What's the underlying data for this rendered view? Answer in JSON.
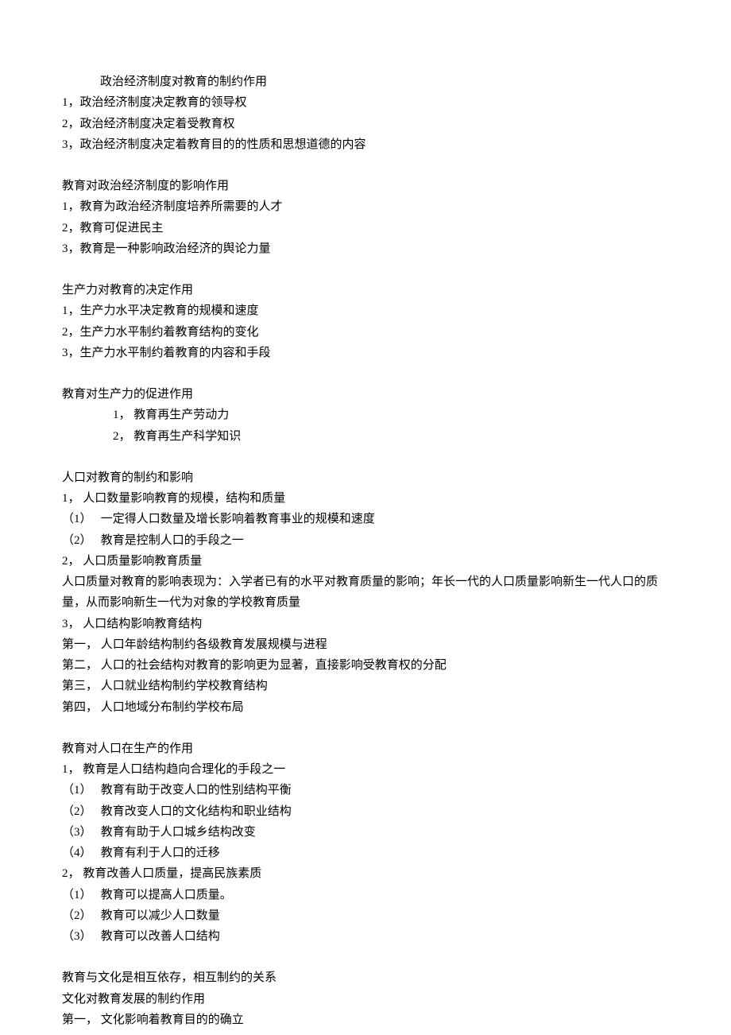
{
  "lines": [
    {
      "cls": "indent1",
      "text": "政治经济制度对教育的制约作用"
    },
    {
      "cls": "",
      "text": "1，政治经济制度决定教育的领导权"
    },
    {
      "cls": "",
      "text": "2，政治经济制度决定着受教育权"
    },
    {
      "cls": "",
      "text": "3，政治经济制度决定着教育目的的性质和思想道德的内容"
    },
    {
      "cls": "blank",
      "text": ""
    },
    {
      "cls": "",
      "text": "教育对政治经济制度的影响作用"
    },
    {
      "cls": "",
      "text": "1，教育为政治经济制度培养所需要的人才"
    },
    {
      "cls": "",
      "text": "2，教育可促进民主"
    },
    {
      "cls": "",
      "text": "3，教育是一种影响政治经济的舆论力量"
    },
    {
      "cls": "blank",
      "text": ""
    },
    {
      "cls": "",
      "text": "生产力对教育的决定作用"
    },
    {
      "cls": "",
      "text": "1，生产力水平决定教育的规模和速度"
    },
    {
      "cls": "",
      "text": "2，生产力水平制约着教育结构的变化"
    },
    {
      "cls": "",
      "text": "3，生产力水平制约着教育的内容和手段"
    },
    {
      "cls": "blank",
      "text": ""
    },
    {
      "cls": "",
      "text": "教育对生产力的促进作用"
    },
    {
      "cls": "indent2",
      "text": "1， 教育再生产劳动力"
    },
    {
      "cls": "indent2",
      "text": "2， 教育再生产科学知识"
    },
    {
      "cls": "blank",
      "text": ""
    },
    {
      "cls": "",
      "text": "人口对教育的制约和影响"
    },
    {
      "cls": "",
      "text": "1， 人口数量影响教育的规模，结构和质量"
    },
    {
      "cls": "",
      "text": "（1）   一定得人口数量及增长影响着教育事业的规模和速度"
    },
    {
      "cls": "",
      "text": "（2）   教育是控制人口的手段之一"
    },
    {
      "cls": "",
      "text": "2， 人口质量影响教育质量"
    },
    {
      "cls": "",
      "text": "人口质量对教育的影响表现为：入学者已有的水平对教育质量的影响；年长一代的人口质量影响新生一代人口的质量，从而影响新生一代为对象的学校教育质量"
    },
    {
      "cls": "",
      "text": "3， 人口结构影响教育结构"
    },
    {
      "cls": "",
      "text": "第一， 人口年龄结构制约各级教育发展规模与进程"
    },
    {
      "cls": "",
      "text": "第二， 人口的社会结构对教育的影响更为显著，直接影响受教育权的分配"
    },
    {
      "cls": "",
      "text": "第三， 人口就业结构制约学校教育结构"
    },
    {
      "cls": "",
      "text": "第四， 人口地域分布制约学校布局"
    },
    {
      "cls": "blank",
      "text": ""
    },
    {
      "cls": "",
      "text": "教育对人口在生产的作用"
    },
    {
      "cls": "",
      "text": "1， 教育是人口结构趋向合理化的手段之一"
    },
    {
      "cls": "",
      "text": "（1）   教育有助于改变人口的性别结构平衡"
    },
    {
      "cls": "",
      "text": "（2）   教育改变人口的文化结构和职业结构"
    },
    {
      "cls": "",
      "text": "（3）   教育有助于人口城乡结构改变"
    },
    {
      "cls": "",
      "text": "（4）   教育有利于人口的迁移"
    },
    {
      "cls": "",
      "text": "2， 教育改善人口质量，提高民族素质"
    },
    {
      "cls": "",
      "text": "（1）   教育可以提高人口质量。"
    },
    {
      "cls": "",
      "text": "（2）   教育可以减少人口数量"
    },
    {
      "cls": "",
      "text": "（3）   教育可以改善人口结构"
    },
    {
      "cls": "blank",
      "text": ""
    },
    {
      "cls": "",
      "text": "教育与文化是相互依存，相互制约的关系"
    },
    {
      "cls": "",
      "text": "文化对教育发展的制约作用"
    },
    {
      "cls": "",
      "text": "第一， 文化影响着教育目的的确立"
    }
  ]
}
